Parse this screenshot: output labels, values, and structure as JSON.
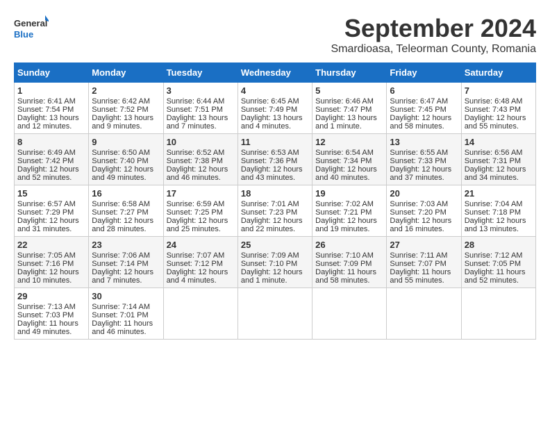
{
  "logo": {
    "line1": "General",
    "line2": "Blue"
  },
  "title": "September 2024",
  "subtitle": "Smardioasa, Teleorman County, Romania",
  "weekdays": [
    "Sunday",
    "Monday",
    "Tuesday",
    "Wednesday",
    "Thursday",
    "Friday",
    "Saturday"
  ],
  "weeks": [
    [
      {
        "day": 1,
        "lines": [
          "Sunrise: 6:41 AM",
          "Sunset: 7:54 PM",
          "Daylight: 13 hours",
          "and 12 minutes."
        ]
      },
      {
        "day": 2,
        "lines": [
          "Sunrise: 6:42 AM",
          "Sunset: 7:52 PM",
          "Daylight: 13 hours",
          "and 9 minutes."
        ]
      },
      {
        "day": 3,
        "lines": [
          "Sunrise: 6:44 AM",
          "Sunset: 7:51 PM",
          "Daylight: 13 hours",
          "and 7 minutes."
        ]
      },
      {
        "day": 4,
        "lines": [
          "Sunrise: 6:45 AM",
          "Sunset: 7:49 PM",
          "Daylight: 13 hours",
          "and 4 minutes."
        ]
      },
      {
        "day": 5,
        "lines": [
          "Sunrise: 6:46 AM",
          "Sunset: 7:47 PM",
          "Daylight: 13 hours",
          "and 1 minute."
        ]
      },
      {
        "day": 6,
        "lines": [
          "Sunrise: 6:47 AM",
          "Sunset: 7:45 PM",
          "Daylight: 12 hours",
          "and 58 minutes."
        ]
      },
      {
        "day": 7,
        "lines": [
          "Sunrise: 6:48 AM",
          "Sunset: 7:43 PM",
          "Daylight: 12 hours",
          "and 55 minutes."
        ]
      }
    ],
    [
      {
        "day": 8,
        "lines": [
          "Sunrise: 6:49 AM",
          "Sunset: 7:42 PM",
          "Daylight: 12 hours",
          "and 52 minutes."
        ]
      },
      {
        "day": 9,
        "lines": [
          "Sunrise: 6:50 AM",
          "Sunset: 7:40 PM",
          "Daylight: 12 hours",
          "and 49 minutes."
        ]
      },
      {
        "day": 10,
        "lines": [
          "Sunrise: 6:52 AM",
          "Sunset: 7:38 PM",
          "Daylight: 12 hours",
          "and 46 minutes."
        ]
      },
      {
        "day": 11,
        "lines": [
          "Sunrise: 6:53 AM",
          "Sunset: 7:36 PM",
          "Daylight: 12 hours",
          "and 43 minutes."
        ]
      },
      {
        "day": 12,
        "lines": [
          "Sunrise: 6:54 AM",
          "Sunset: 7:34 PM",
          "Daylight: 12 hours",
          "and 40 minutes."
        ]
      },
      {
        "day": 13,
        "lines": [
          "Sunrise: 6:55 AM",
          "Sunset: 7:33 PM",
          "Daylight: 12 hours",
          "and 37 minutes."
        ]
      },
      {
        "day": 14,
        "lines": [
          "Sunrise: 6:56 AM",
          "Sunset: 7:31 PM",
          "Daylight: 12 hours",
          "and 34 minutes."
        ]
      }
    ],
    [
      {
        "day": 15,
        "lines": [
          "Sunrise: 6:57 AM",
          "Sunset: 7:29 PM",
          "Daylight: 12 hours",
          "and 31 minutes."
        ]
      },
      {
        "day": 16,
        "lines": [
          "Sunrise: 6:58 AM",
          "Sunset: 7:27 PM",
          "Daylight: 12 hours",
          "and 28 minutes."
        ]
      },
      {
        "day": 17,
        "lines": [
          "Sunrise: 6:59 AM",
          "Sunset: 7:25 PM",
          "Daylight: 12 hours",
          "and 25 minutes."
        ]
      },
      {
        "day": 18,
        "lines": [
          "Sunrise: 7:01 AM",
          "Sunset: 7:23 PM",
          "Daylight: 12 hours",
          "and 22 minutes."
        ]
      },
      {
        "day": 19,
        "lines": [
          "Sunrise: 7:02 AM",
          "Sunset: 7:21 PM",
          "Daylight: 12 hours",
          "and 19 minutes."
        ]
      },
      {
        "day": 20,
        "lines": [
          "Sunrise: 7:03 AM",
          "Sunset: 7:20 PM",
          "Daylight: 12 hours",
          "and 16 minutes."
        ]
      },
      {
        "day": 21,
        "lines": [
          "Sunrise: 7:04 AM",
          "Sunset: 7:18 PM",
          "Daylight: 12 hours",
          "and 13 minutes."
        ]
      }
    ],
    [
      {
        "day": 22,
        "lines": [
          "Sunrise: 7:05 AM",
          "Sunset: 7:16 PM",
          "Daylight: 12 hours",
          "and 10 minutes."
        ]
      },
      {
        "day": 23,
        "lines": [
          "Sunrise: 7:06 AM",
          "Sunset: 7:14 PM",
          "Daylight: 12 hours",
          "and 7 minutes."
        ]
      },
      {
        "day": 24,
        "lines": [
          "Sunrise: 7:07 AM",
          "Sunset: 7:12 PM",
          "Daylight: 12 hours",
          "and 4 minutes."
        ]
      },
      {
        "day": 25,
        "lines": [
          "Sunrise: 7:09 AM",
          "Sunset: 7:10 PM",
          "Daylight: 12 hours",
          "and 1 minute."
        ]
      },
      {
        "day": 26,
        "lines": [
          "Sunrise: 7:10 AM",
          "Sunset: 7:09 PM",
          "Daylight: 11 hours",
          "and 58 minutes."
        ]
      },
      {
        "day": 27,
        "lines": [
          "Sunrise: 7:11 AM",
          "Sunset: 7:07 PM",
          "Daylight: 11 hours",
          "and 55 minutes."
        ]
      },
      {
        "day": 28,
        "lines": [
          "Sunrise: 7:12 AM",
          "Sunset: 7:05 PM",
          "Daylight: 11 hours",
          "and 52 minutes."
        ]
      }
    ],
    [
      {
        "day": 29,
        "lines": [
          "Sunrise: 7:13 AM",
          "Sunset: 7:03 PM",
          "Daylight: 11 hours",
          "and 49 minutes."
        ]
      },
      {
        "day": 30,
        "lines": [
          "Sunrise: 7:14 AM",
          "Sunset: 7:01 PM",
          "Daylight: 11 hours",
          "and 46 minutes."
        ]
      },
      null,
      null,
      null,
      null,
      null
    ]
  ]
}
